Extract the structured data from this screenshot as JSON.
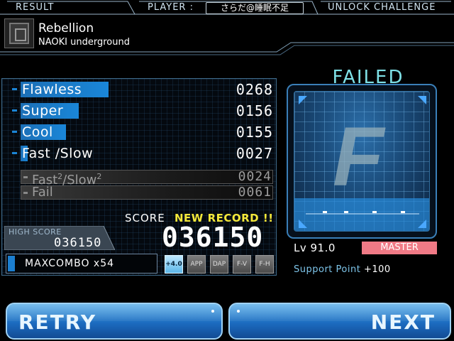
{
  "header": {
    "result_label": "RESULT",
    "player_label": "PLAYER :",
    "player_name": "さらだ@睡眠不足",
    "unlock_label": "UNLOCK CHALLENGE"
  },
  "song": {
    "title": "Rebellion",
    "artist": "NAOKI underground"
  },
  "judgments": [
    {
      "label": "Flawless",
      "value": "0268"
    },
    {
      "label": "Super",
      "value": "0156"
    },
    {
      "label": "Cool",
      "value": "0155"
    },
    {
      "label": "Fast /Slow",
      "value": "0027"
    }
  ],
  "sub_judgments": {
    "fastslow_label_a": "Fast",
    "fastslow_label_b": "/Slow",
    "sup": "2",
    "fastslow_value": "0024",
    "fail_label": "Fail",
    "fail_value": "0061"
  },
  "score": {
    "label": "SCORE",
    "new_record": "NEW RECORD !!",
    "value": "036150",
    "high_score_label": "HIGH SCORE",
    "high_score_value": "036150"
  },
  "maxcombo": "MAXCOMBO x54",
  "options": [
    "+4.0",
    "APP",
    "DAP",
    "F-V",
    "F-H"
  ],
  "grade": {
    "status": "FAILED",
    "letter": "F"
  },
  "level": "Lv 91.0",
  "difficulty": "MASTER",
  "support": {
    "label": "Support Point",
    "value": "+100"
  },
  "buttons": {
    "retry": "RETRY",
    "next": "NEXT"
  },
  "colors": {
    "accent_blue": "#1b85d6",
    "failed_text": "#7ee0e6",
    "new_record": "#f4e83a",
    "master_badge": "#f07a86"
  }
}
